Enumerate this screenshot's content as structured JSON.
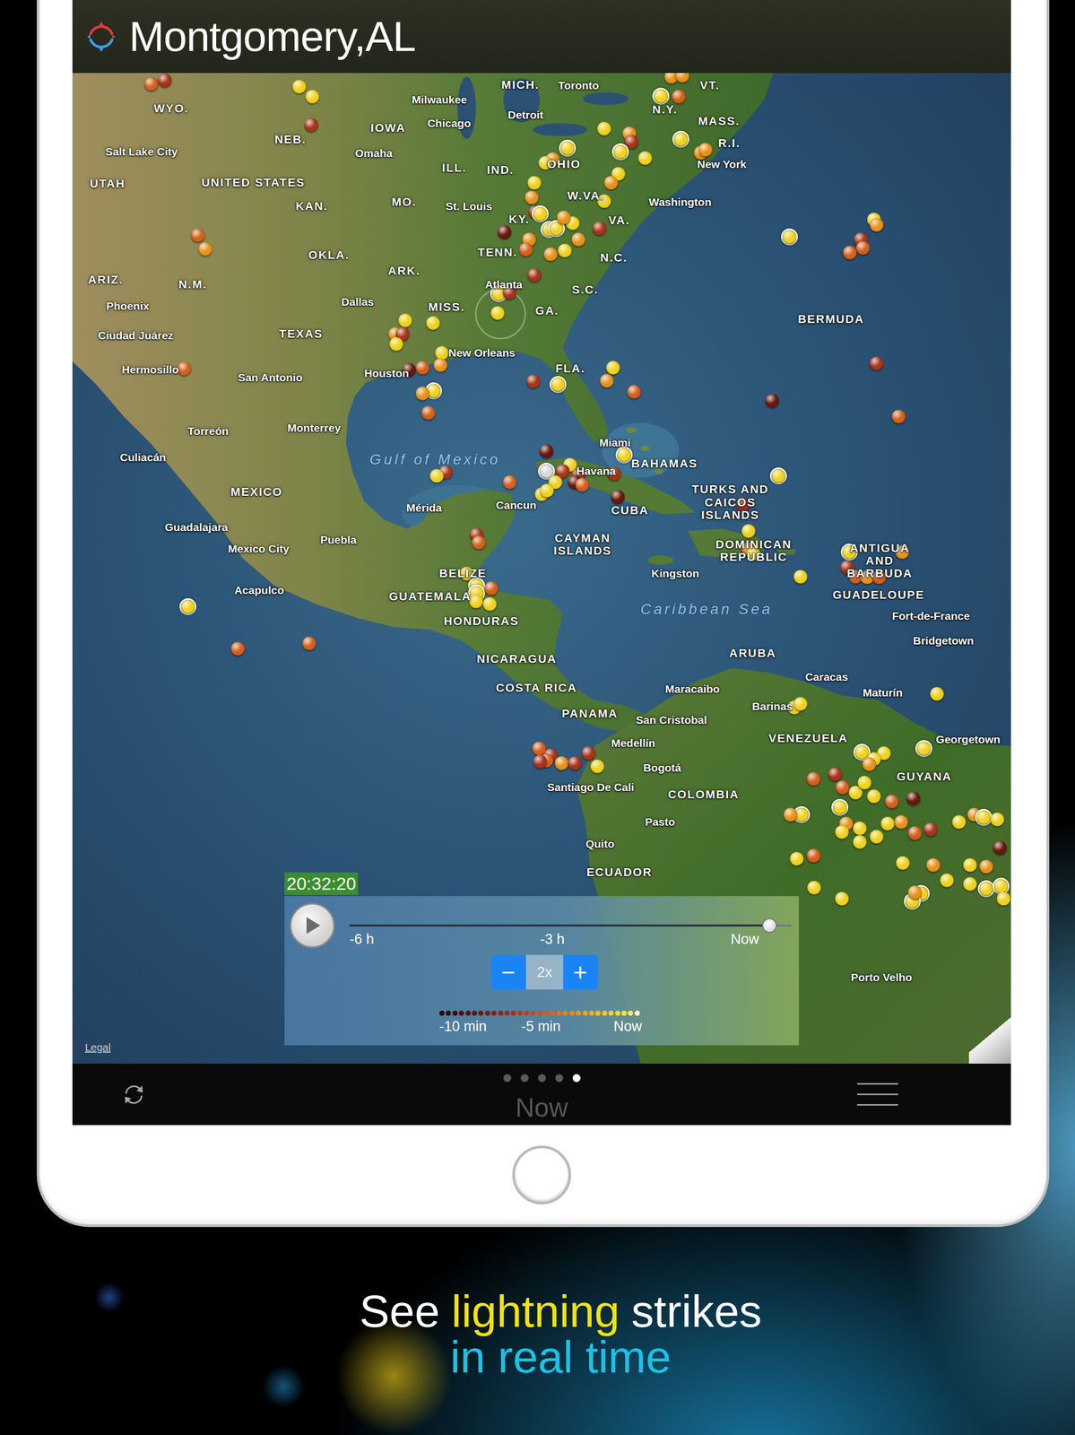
{
  "header": {
    "title": "Montgomery,AL"
  },
  "map": {
    "labels": [
      {
        "text": "WYO.",
        "kind": "region"
      },
      {
        "text": "Salt Lake City",
        "kind": "city"
      },
      {
        "text": "NEB.",
        "kind": "region"
      },
      {
        "text": "IOWA",
        "kind": "region"
      },
      {
        "text": "Omaha",
        "kind": "city"
      },
      {
        "text": "Milwaukee",
        "kind": "city"
      },
      {
        "text": "Chicago",
        "kind": "city"
      },
      {
        "text": "MICH.",
        "kind": "region"
      },
      {
        "text": "Toronto",
        "kind": "city"
      },
      {
        "text": "Detroit",
        "kind": "city"
      },
      {
        "text": "VT.",
        "kind": "region"
      },
      {
        "text": "N.Y.",
        "kind": "region"
      },
      {
        "text": "MASS.",
        "kind": "region"
      },
      {
        "text": "R.I.",
        "kind": "region"
      },
      {
        "text": "New York",
        "kind": "city"
      },
      {
        "text": "UTAH",
        "kind": "region"
      },
      {
        "text": "UNITED STATES",
        "kind": "region"
      },
      {
        "text": "ILL.",
        "kind": "region"
      },
      {
        "text": "IND.",
        "kind": "region"
      },
      {
        "text": "OHIO",
        "kind": "region"
      },
      {
        "text": "KAN.",
        "kind": "region"
      },
      {
        "text": "MO.",
        "kind": "region"
      },
      {
        "text": "St. Louis",
        "kind": "city"
      },
      {
        "text": "W.VA.",
        "kind": "region"
      },
      {
        "text": "Washington",
        "kind": "city"
      },
      {
        "text": "KY.",
        "kind": "region"
      },
      {
        "text": "VA.",
        "kind": "region"
      },
      {
        "text": "OKLA.",
        "kind": "region"
      },
      {
        "text": "TENN.",
        "kind": "region"
      },
      {
        "text": "N.C.",
        "kind": "region"
      },
      {
        "text": "ARK.",
        "kind": "region"
      },
      {
        "text": "ARIZ.",
        "kind": "region"
      },
      {
        "text": "N.M.",
        "kind": "region"
      },
      {
        "text": "Phoenix",
        "kind": "city"
      },
      {
        "text": "Dallas",
        "kind": "city"
      },
      {
        "text": "MISS.",
        "kind": "region"
      },
      {
        "text": "Atlanta",
        "kind": "city"
      },
      {
        "text": "S.C.",
        "kind": "region"
      },
      {
        "text": "GA.",
        "kind": "region"
      },
      {
        "text": "BERMUDA",
        "kind": "region"
      },
      {
        "text": "Ciudad Juárez",
        "kind": "city"
      },
      {
        "text": "TEXAS",
        "kind": "region"
      },
      {
        "text": "New Orleans",
        "kind": "city"
      },
      {
        "text": "Hermosillo",
        "kind": "city"
      },
      {
        "text": "San Antonio",
        "kind": "city"
      },
      {
        "text": "Houston",
        "kind": "city"
      },
      {
        "text": "FLA.",
        "kind": "region"
      },
      {
        "text": "Torreón",
        "kind": "city"
      },
      {
        "text": "Monterrey",
        "kind": "city"
      },
      {
        "text": "Miami",
        "kind": "city"
      },
      {
        "text": "Culiacán",
        "kind": "city"
      },
      {
        "text": "Gulf of Mexico",
        "kind": "water"
      },
      {
        "text": "BAHAMAS",
        "kind": "region"
      },
      {
        "text": "Havana",
        "kind": "city"
      },
      {
        "text": "MEXICO",
        "kind": "region"
      },
      {
        "text": "Mérida",
        "kind": "city"
      },
      {
        "text": "Cancun",
        "kind": "city"
      },
      {
        "text": "CUBA",
        "kind": "region"
      },
      {
        "text": "TURKS AND CAICOS ISLANDS",
        "kind": "region"
      },
      {
        "text": "Guadalajara",
        "kind": "city"
      },
      {
        "text": "Puebla",
        "kind": "city"
      },
      {
        "text": "Mexico City",
        "kind": "city"
      },
      {
        "text": "CAYMAN ISLANDS",
        "kind": "region"
      },
      {
        "text": "DOMINICAN REPUBLIC",
        "kind": "region"
      },
      {
        "text": "ANTIGUA AND BARBUDA",
        "kind": "region"
      },
      {
        "text": "Kingston",
        "kind": "city"
      },
      {
        "text": "BELIZE",
        "kind": "region"
      },
      {
        "text": "GUATEMALA",
        "kind": "region"
      },
      {
        "text": "Acapulco",
        "kind": "city"
      },
      {
        "text": "GUADELOUPE",
        "kind": "region"
      },
      {
        "text": "Caribbean Sea",
        "kind": "water"
      },
      {
        "text": "Fort-de-France",
        "kind": "city"
      },
      {
        "text": "HONDURAS",
        "kind": "region"
      },
      {
        "text": "Bridgetown",
        "kind": "city"
      },
      {
        "text": "ARUBA",
        "kind": "region"
      },
      {
        "text": "NICARAGUA",
        "kind": "region"
      },
      {
        "text": "Caracas",
        "kind": "city"
      },
      {
        "text": "Maracaibo",
        "kind": "city"
      },
      {
        "text": "Maturín",
        "kind": "city"
      },
      {
        "text": "COSTA RICA",
        "kind": "region"
      },
      {
        "text": "Barinas",
        "kind": "city"
      },
      {
        "text": "PANAMA",
        "kind": "region"
      },
      {
        "text": "San Cristobal",
        "kind": "city"
      },
      {
        "text": "VENEZUELA",
        "kind": "region"
      },
      {
        "text": "Georgetown",
        "kind": "city"
      },
      {
        "text": "Medellín",
        "kind": "city"
      },
      {
        "text": "Bogotá",
        "kind": "city"
      },
      {
        "text": "GUYANA",
        "kind": "region"
      },
      {
        "text": "Santiago De Cali",
        "kind": "city"
      },
      {
        "text": "COLOMBIA",
        "kind": "region"
      },
      {
        "text": "Pasto",
        "kind": "city"
      },
      {
        "text": "Quito",
        "kind": "city"
      },
      {
        "text": "ECUADOR",
        "kind": "region"
      },
      {
        "text": "Porto Velho",
        "kind": "city"
      }
    ],
    "strikes": [
      {
        "color": "#d4601c",
        "ring": false
      },
      {
        "color": "#a8341a",
        "ring": false
      },
      {
        "color": "#f0d21c",
        "ring": false
      },
      {
        "color": "#f0d21c",
        "ring": false
      },
      {
        "color": "#a8341a",
        "ring": false
      },
      {
        "color": "#d4601c",
        "ring": false
      },
      {
        "color": "#e8921a",
        "ring": false
      },
      {
        "color": "#d4601c",
        "ring": false
      },
      {
        "color": "#f0d21c",
        "ring": true
      },
      {
        "color": "#d4601c",
        "ring": false
      },
      {
        "color": "#e8921a",
        "ring": false
      },
      {
        "color": "#e8921a",
        "ring": false
      },
      {
        "color": "#f0d21c",
        "ring": false
      },
      {
        "color": "#e8921a",
        "ring": false
      },
      {
        "color": "#a8341a",
        "ring": false
      },
      {
        "color": "#f0d21c",
        "ring": true
      },
      {
        "color": "#f0d21c",
        "ring": true
      },
      {
        "color": "#f0d21c",
        "ring": false
      },
      {
        "color": "#e8921a",
        "ring": false
      },
      {
        "color": "#f0d21c",
        "ring": false
      },
      {
        "color": "#f0d21c",
        "ring": true
      },
      {
        "color": "#e8921a",
        "ring": false
      },
      {
        "color": "#e8921a",
        "ring": false
      },
      {
        "color": "#f0d21c",
        "ring": false
      },
      {
        "color": "#e8921a",
        "ring": false
      },
      {
        "color": "#f0d21c",
        "ring": false
      },
      {
        "color": "#f0d21c",
        "ring": false
      },
      {
        "color": "#e8921a",
        "ring": false
      },
      {
        "color": "#a8341a",
        "ring": false
      },
      {
        "color": "#f0d21c",
        "ring": true
      },
      {
        "color": "#f0d21c",
        "ring": true
      },
      {
        "color": "#f0d21c",
        "ring": true
      },
      {
        "color": "#f0d21c",
        "ring": false
      },
      {
        "color": "#e8921a",
        "ring": false
      },
      {
        "color": "#a8341a",
        "ring": false
      },
      {
        "color": "#6a180c",
        "ring": false
      },
      {
        "color": "#e8921a",
        "ring": false
      },
      {
        "color": "#d4601c",
        "ring": false
      },
      {
        "color": "#e8921a",
        "ring": false
      },
      {
        "color": "#f0d21c",
        "ring": false
      },
      {
        "color": "#e8921a",
        "ring": false
      },
      {
        "color": "#a8341a",
        "ring": false
      },
      {
        "color": "#f0d21c",
        "ring": true
      },
      {
        "color": "#a8341a",
        "ring": false
      },
      {
        "color": "#f0d21c",
        "ring": false
      },
      {
        "color": "#f0d21c",
        "ring": false
      },
      {
        "color": "#f0d21c",
        "ring": false
      },
      {
        "color": "#e8921a",
        "ring": false
      },
      {
        "color": "#a8341a",
        "ring": false
      },
      {
        "color": "#f0d21c",
        "ring": false
      },
      {
        "color": "#f0d21c",
        "ring": false
      },
      {
        "color": "#d4601c",
        "ring": false
      },
      {
        "color": "#e8921a",
        "ring": false
      },
      {
        "color": "#6a180c",
        "ring": false
      },
      {
        "color": "#f0d21c",
        "ring": true
      },
      {
        "color": "#e8921a",
        "ring": false
      },
      {
        "color": "#d4601c",
        "ring": false
      },
      {
        "color": "#f0d21c",
        "ring": true
      },
      {
        "color": "#a8341a",
        "ring": false
      },
      {
        "color": "#f0d21c",
        "ring": false
      },
      {
        "color": "#e8921a",
        "ring": false
      },
      {
        "color": "#d4601c",
        "ring": false
      },
      {
        "color": "#f0d21c",
        "ring": true
      },
      {
        "color": "#f0d21c",
        "ring": false
      },
      {
        "color": "#e8921a",
        "ring": false
      },
      {
        "color": "#a8341a",
        "ring": false
      },
      {
        "color": "#d4601c",
        "ring": false
      },
      {
        "color": "#d4601c",
        "ring": false
      },
      {
        "color": "#a8341a",
        "ring": false
      },
      {
        "color": "#6a180c",
        "ring": false
      },
      {
        "color": "#d4601c",
        "ring": false
      },
      {
        "color": "#6a180c",
        "ring": false
      },
      {
        "color": "#f0d21c",
        "ring": true
      },
      {
        "color": "#f0d21c",
        "ring": false
      },
      {
        "color": "#d8d8d8",
        "ring": true
      },
      {
        "color": "#a8341a",
        "ring": false
      },
      {
        "color": "#a8341a",
        "ring": false
      },
      {
        "color": "#6a180c",
        "ring": false
      },
      {
        "color": "#d4601c",
        "ring": false
      },
      {
        "color": "#f0d21c",
        "ring": false
      },
      {
        "color": "#f0d21c",
        "ring": false
      },
      {
        "color": "#f0d21c",
        "ring": false
      },
      {
        "color": "#d4601c",
        "ring": false
      },
      {
        "color": "#a8341a",
        "ring": false
      },
      {
        "color": "#f0d21c",
        "ring": false
      },
      {
        "color": "#6a180c",
        "ring": false
      },
      {
        "color": "#a8341a",
        "ring": false
      },
      {
        "color": "#f0d21c",
        "ring": true
      },
      {
        "color": "#a8341a",
        "ring": false
      },
      {
        "color": "#f0d21c",
        "ring": false
      },
      {
        "color": "#e8921a",
        "ring": false
      },
      {
        "color": "#f0d21c",
        "ring": false
      },
      {
        "color": "#f0d21c",
        "ring": false
      },
      {
        "color": "#f0d21c",
        "ring": true
      },
      {
        "color": "#a8341a",
        "ring": false
      },
      {
        "color": "#d4601c",
        "ring": false
      },
      {
        "color": "#e8921a",
        "ring": false
      },
      {
        "color": "#d4601c",
        "ring": false
      },
      {
        "color": "#e8921a",
        "ring": false
      },
      {
        "color": "#a8341a",
        "ring": false
      },
      {
        "color": "#d4601c",
        "ring": false
      },
      {
        "color": "#f0d21c",
        "ring": false
      },
      {
        "color": "#f0d21c",
        "ring": true
      },
      {
        "color": "#f0d21c",
        "ring": true
      },
      {
        "color": "#f0d21c",
        "ring": false
      },
      {
        "color": "#d4601c",
        "ring": false
      },
      {
        "color": "#f0d21c",
        "ring": false
      },
      {
        "color": "#f0d21c",
        "ring": true
      },
      {
        "color": "#d4601c",
        "ring": false
      },
      {
        "color": "#d4601c",
        "ring": false
      },
      {
        "color": "#d4601c",
        "ring": false
      },
      {
        "color": "#a8341a",
        "ring": false
      },
      {
        "color": "#d4601c",
        "ring": false
      },
      {
        "color": "#a8341a",
        "ring": false
      },
      {
        "color": "#e8921a",
        "ring": false
      },
      {
        "color": "#a8341a",
        "ring": false
      },
      {
        "color": "#a8341a",
        "ring": false
      },
      {
        "color": "#f0d21c",
        "ring": false
      },
      {
        "color": "#f0d21c",
        "ring": false
      },
      {
        "color": "#f0d21c",
        "ring": false
      },
      {
        "color": "#f0d21c",
        "ring": false
      },
      {
        "color": "#f0d21c",
        "ring": true
      },
      {
        "color": "#f0d21c",
        "ring": false
      },
      {
        "color": "#f0d21c",
        "ring": false
      },
      {
        "color": "#e8921a",
        "ring": false
      },
      {
        "color": "#f0d21c",
        "ring": true
      },
      {
        "color": "#d4601c",
        "ring": false
      },
      {
        "color": "#a8341a",
        "ring": false
      },
      {
        "color": "#d4601c",
        "ring": false
      },
      {
        "color": "#f0d21c",
        "ring": false
      },
      {
        "color": "#f0d21c",
        "ring": false
      },
      {
        "color": "#f0d21c",
        "ring": false
      },
      {
        "color": "#d4601c",
        "ring": false
      },
      {
        "color": "#6a180c",
        "ring": false
      },
      {
        "color": "#f0d21c",
        "ring": true
      },
      {
        "color": "#e8921a",
        "ring": false
      },
      {
        "color": "#f0d21c",
        "ring": true
      },
      {
        "color": "#e8921a",
        "ring": false
      },
      {
        "color": "#f0d21c",
        "ring": false
      },
      {
        "color": "#f0d21c",
        "ring": false
      },
      {
        "color": "#f0d21c",
        "ring": false
      },
      {
        "color": "#e8921a",
        "ring": false
      },
      {
        "color": "#d4601c",
        "ring": false
      },
      {
        "color": "#a8341a",
        "ring": false
      },
      {
        "color": "#f0d21c",
        "ring": false
      },
      {
        "color": "#f0d21c",
        "ring": false
      },
      {
        "color": "#f0d21c",
        "ring": false
      },
      {
        "color": "#e8921a",
        "ring": false
      },
      {
        "color": "#f0d21c",
        "ring": true
      },
      {
        "color": "#f0d21c",
        "ring": false
      },
      {
        "color": "#6a180c",
        "ring": false
      },
      {
        "color": "#f0d21c",
        "ring": false
      },
      {
        "color": "#d4601c",
        "ring": false
      },
      {
        "color": "#f0d21c",
        "ring": false
      },
      {
        "color": "#e8921a",
        "ring": false
      },
      {
        "color": "#f0d21c",
        "ring": false
      },
      {
        "color": "#e8921a",
        "ring": false
      },
      {
        "color": "#f0d21c",
        "ring": false
      },
      {
        "color": "#f0d21c",
        "ring": false
      },
      {
        "color": "#f0d21c",
        "ring": true
      },
      {
        "color": "#f0d21c",
        "ring": true
      },
      {
        "color": "#f0d21c",
        "ring": false
      },
      {
        "color": "#f0d21c",
        "ring": true
      },
      {
        "color": "#f0d21c",
        "ring": true
      },
      {
        "color": "#f0d21c",
        "ring": false
      },
      {
        "color": "#f0d21c",
        "ring": false
      },
      {
        "color": "#e8921a",
        "ring": false
      }
    ],
    "legal": "Legal"
  },
  "timeline": {
    "time": "20:32:20",
    "ticks": [
      "-6 h",
      "-3 h",
      "Now"
    ],
    "level": 0.95,
    "speed": {
      "minus": "−",
      "value": "2x",
      "plus": "+"
    }
  },
  "legend": {
    "colors": [
      "#2a0805",
      "#360a06",
      "#420c07",
      "#4e0f08",
      "#5a1209",
      "#66150a",
      "#72180b",
      "#7e1b0b",
      "#8a1f0c",
      "#96240d",
      "#a2290e",
      "#ae300f",
      "#b83810",
      "#c24011",
      "#c94912",
      "#d05313",
      "#d65d14",
      "#db6815",
      "#e07316",
      "#e47e17",
      "#e88a18",
      "#eb9619",
      "#eea21a",
      "#f0ae1b",
      "#f2ba1c",
      "#f4c61e",
      "#f5d120",
      "#f6da28",
      "#f7e23a",
      "#f8e86a",
      "#faf0c8"
    ],
    "labels": [
      "-10 min",
      "-5 min",
      "Now"
    ]
  },
  "toolbar": {
    "pages": [
      {
        "selected": false
      },
      {
        "selected": false
      },
      {
        "selected": false
      },
      {
        "selected": false
      },
      {
        "selected": true
      }
    ],
    "label": "Now"
  },
  "caption": {
    "line1": [
      {
        "text": "See",
        "color": "#ffffff"
      },
      {
        "text": "lightning",
        "color": "#f4e20c"
      },
      {
        "text": "strikes",
        "color": "#ffffff"
      }
    ],
    "line2": [
      {
        "text": "in real time",
        "color": "#19c3e6"
      }
    ]
  }
}
